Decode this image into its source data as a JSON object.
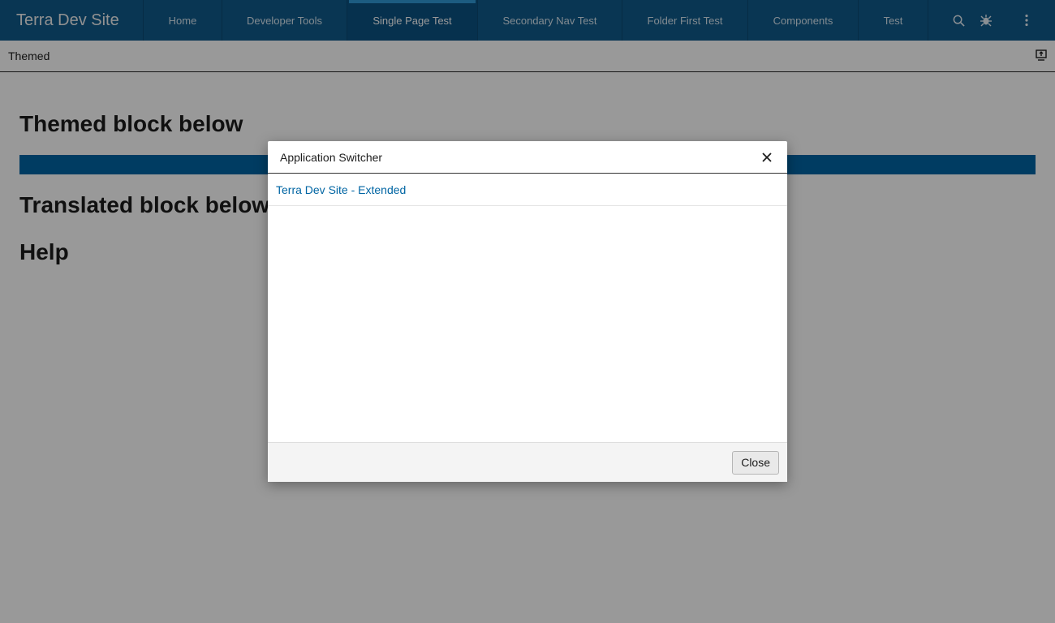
{
  "header": {
    "brand": "Terra Dev Site",
    "nav": [
      {
        "label": "Home",
        "active": false
      },
      {
        "label": "Developer Tools",
        "active": false
      },
      {
        "label": "Single Page Test",
        "active": true
      },
      {
        "label": "Secondary Nav Test",
        "active": false
      },
      {
        "label": "Folder First Test",
        "active": false
      },
      {
        "label": "Components",
        "active": false
      },
      {
        "label": "Test",
        "active": false
      }
    ],
    "tools": {
      "search_icon": "search-icon",
      "theme_icon": "bug-icon",
      "more_icon": "more-vertical-icon"
    }
  },
  "subbar": {
    "title": "Themed",
    "icon": "display-icon"
  },
  "content": {
    "headings": [
      "Themed block below",
      "Translated block below",
      "Help"
    ],
    "themed_block_color": "#0065a3"
  },
  "modal": {
    "title": "Application Switcher",
    "close_icon": "close-icon",
    "items": [
      {
        "label": "Terra Dev Site - Extended"
      }
    ],
    "footer": {
      "close_label": "Close"
    }
  },
  "colors": {
    "header_bg": "#0f5a8a",
    "accent": "#2f9ad8",
    "link": "#0065a3"
  }
}
